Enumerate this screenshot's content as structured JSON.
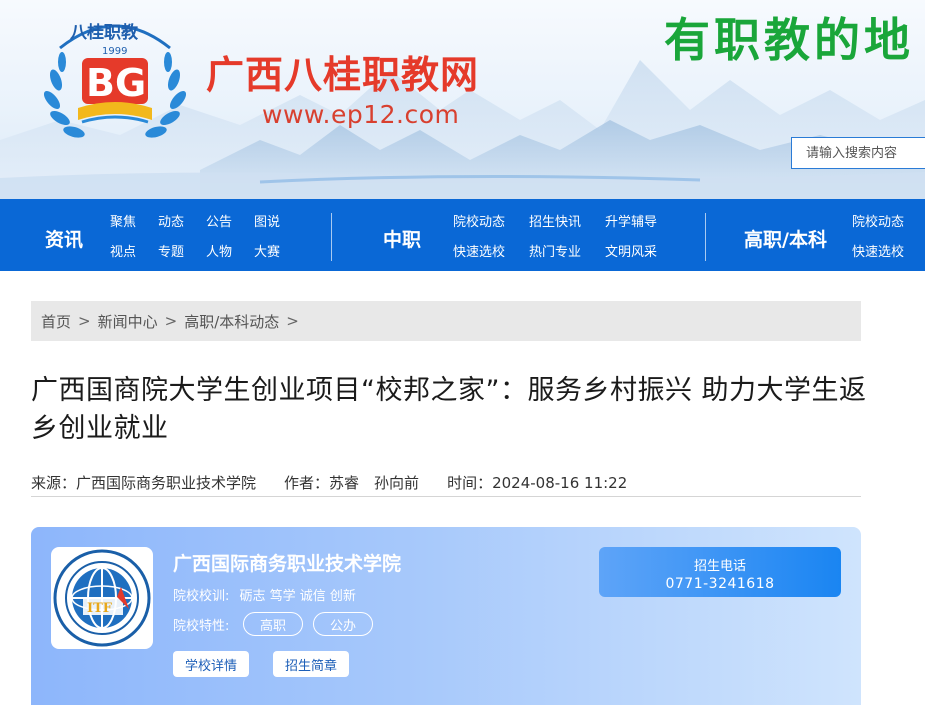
{
  "header": {
    "emblem_text": "八桂职教",
    "emblem_year": "1999",
    "site_name": "广西八桂职教网",
    "site_url": "www.ep12.com",
    "slogan": "有职教的地",
    "search_placeholder": "请输入搜索内容"
  },
  "nav": {
    "sections": [
      {
        "title": "资讯",
        "links": [
          "聚焦",
          "动态",
          "公告",
          "图说",
          "视点",
          "专题",
          "人物",
          "大赛"
        ]
      },
      {
        "title": "中职",
        "links": [
          "院校动态",
          "招生快讯",
          "升学辅导",
          "快速选校",
          "热门专业",
          "文明风采"
        ]
      },
      {
        "title": "高职/本科",
        "links": [
          "院校动态",
          "快速选校"
        ]
      }
    ]
  },
  "breadcrumb": {
    "items": [
      "首页",
      "新闻中心",
      "高职/本科动态"
    ],
    "separator": ">"
  },
  "article": {
    "title": "广西国商院大学生创业项目“校邦之家”：服务乡村振兴 助力大学生返乡创业就业",
    "source_label": "来源：",
    "source": "广西国际商务职业技术学院",
    "author_label": "作者：",
    "authors": "苏睿　孙向前",
    "time_label": "时间：",
    "time": "2024-08-16 11:22"
  },
  "school_card": {
    "name": "广西国际商务职业技术学院",
    "motto_label": "院校校训:",
    "motto": "砺志 笃学 诚信 创新",
    "traits_label": "院校特性:",
    "traits": [
      "高职",
      "公办"
    ],
    "btn_detail": "学校详情",
    "btn_brochure": "招生简章",
    "phone_label": "招生电话",
    "phone": "0771-3241618",
    "logo_text": "ITF"
  },
  "colors": {
    "nav_blue": "#0a68d6",
    "brand_red": "#e53a2a",
    "slogan_green": "#1aa63a",
    "card_gradient_start": "#8db6fb",
    "phone_box_blue": "#1a85f2"
  }
}
